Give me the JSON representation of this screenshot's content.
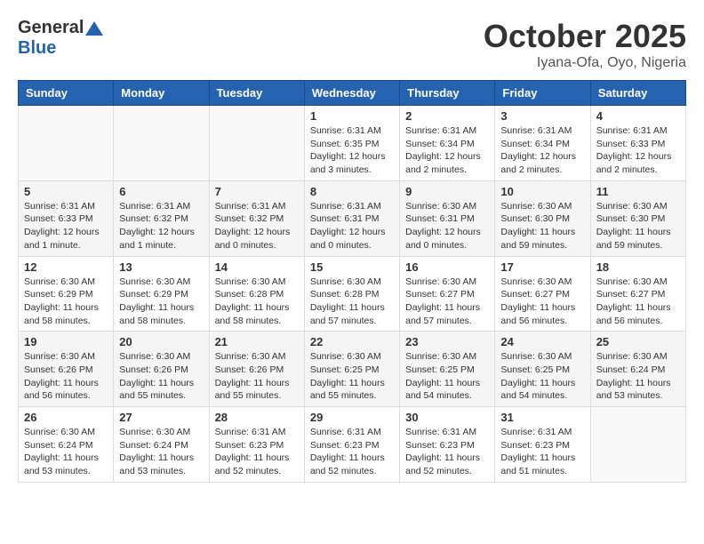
{
  "header": {
    "logo_general": "General",
    "logo_blue": "Blue",
    "month_title": "October 2025",
    "location": "Iyana-Ofa, Oyo, Nigeria"
  },
  "days_of_week": [
    "Sunday",
    "Monday",
    "Tuesday",
    "Wednesday",
    "Thursday",
    "Friday",
    "Saturday"
  ],
  "weeks": [
    [
      {
        "day": "",
        "info": ""
      },
      {
        "day": "",
        "info": ""
      },
      {
        "day": "",
        "info": ""
      },
      {
        "day": "1",
        "info": "Sunrise: 6:31 AM\nSunset: 6:35 PM\nDaylight: 12 hours and 3 minutes."
      },
      {
        "day": "2",
        "info": "Sunrise: 6:31 AM\nSunset: 6:34 PM\nDaylight: 12 hours and 2 minutes."
      },
      {
        "day": "3",
        "info": "Sunrise: 6:31 AM\nSunset: 6:34 PM\nDaylight: 12 hours and 2 minutes."
      },
      {
        "day": "4",
        "info": "Sunrise: 6:31 AM\nSunset: 6:33 PM\nDaylight: 12 hours and 2 minutes."
      }
    ],
    [
      {
        "day": "5",
        "info": "Sunrise: 6:31 AM\nSunset: 6:33 PM\nDaylight: 12 hours and 1 minute."
      },
      {
        "day": "6",
        "info": "Sunrise: 6:31 AM\nSunset: 6:32 PM\nDaylight: 12 hours and 1 minute."
      },
      {
        "day": "7",
        "info": "Sunrise: 6:31 AM\nSunset: 6:32 PM\nDaylight: 12 hours and 0 minutes."
      },
      {
        "day": "8",
        "info": "Sunrise: 6:31 AM\nSunset: 6:31 PM\nDaylight: 12 hours and 0 minutes."
      },
      {
        "day": "9",
        "info": "Sunrise: 6:30 AM\nSunset: 6:31 PM\nDaylight: 12 hours and 0 minutes."
      },
      {
        "day": "10",
        "info": "Sunrise: 6:30 AM\nSunset: 6:30 PM\nDaylight: 11 hours and 59 minutes."
      },
      {
        "day": "11",
        "info": "Sunrise: 6:30 AM\nSunset: 6:30 PM\nDaylight: 11 hours and 59 minutes."
      }
    ],
    [
      {
        "day": "12",
        "info": "Sunrise: 6:30 AM\nSunset: 6:29 PM\nDaylight: 11 hours and 58 minutes."
      },
      {
        "day": "13",
        "info": "Sunrise: 6:30 AM\nSunset: 6:29 PM\nDaylight: 11 hours and 58 minutes."
      },
      {
        "day": "14",
        "info": "Sunrise: 6:30 AM\nSunset: 6:28 PM\nDaylight: 11 hours and 58 minutes."
      },
      {
        "day": "15",
        "info": "Sunrise: 6:30 AM\nSunset: 6:28 PM\nDaylight: 11 hours and 57 minutes."
      },
      {
        "day": "16",
        "info": "Sunrise: 6:30 AM\nSunset: 6:27 PM\nDaylight: 11 hours and 57 minutes."
      },
      {
        "day": "17",
        "info": "Sunrise: 6:30 AM\nSunset: 6:27 PM\nDaylight: 11 hours and 56 minutes."
      },
      {
        "day": "18",
        "info": "Sunrise: 6:30 AM\nSunset: 6:27 PM\nDaylight: 11 hours and 56 minutes."
      }
    ],
    [
      {
        "day": "19",
        "info": "Sunrise: 6:30 AM\nSunset: 6:26 PM\nDaylight: 11 hours and 56 minutes."
      },
      {
        "day": "20",
        "info": "Sunrise: 6:30 AM\nSunset: 6:26 PM\nDaylight: 11 hours and 55 minutes."
      },
      {
        "day": "21",
        "info": "Sunrise: 6:30 AM\nSunset: 6:26 PM\nDaylight: 11 hours and 55 minutes."
      },
      {
        "day": "22",
        "info": "Sunrise: 6:30 AM\nSunset: 6:25 PM\nDaylight: 11 hours and 55 minutes."
      },
      {
        "day": "23",
        "info": "Sunrise: 6:30 AM\nSunset: 6:25 PM\nDaylight: 11 hours and 54 minutes."
      },
      {
        "day": "24",
        "info": "Sunrise: 6:30 AM\nSunset: 6:25 PM\nDaylight: 11 hours and 54 minutes."
      },
      {
        "day": "25",
        "info": "Sunrise: 6:30 AM\nSunset: 6:24 PM\nDaylight: 11 hours and 53 minutes."
      }
    ],
    [
      {
        "day": "26",
        "info": "Sunrise: 6:30 AM\nSunset: 6:24 PM\nDaylight: 11 hours and 53 minutes."
      },
      {
        "day": "27",
        "info": "Sunrise: 6:30 AM\nSunset: 6:24 PM\nDaylight: 11 hours and 53 minutes."
      },
      {
        "day": "28",
        "info": "Sunrise: 6:31 AM\nSunset: 6:23 PM\nDaylight: 11 hours and 52 minutes."
      },
      {
        "day": "29",
        "info": "Sunrise: 6:31 AM\nSunset: 6:23 PM\nDaylight: 11 hours and 52 minutes."
      },
      {
        "day": "30",
        "info": "Sunrise: 6:31 AM\nSunset: 6:23 PM\nDaylight: 11 hours and 52 minutes."
      },
      {
        "day": "31",
        "info": "Sunrise: 6:31 AM\nSunset: 6:23 PM\nDaylight: 11 hours and 51 minutes."
      },
      {
        "day": "",
        "info": ""
      }
    ]
  ]
}
